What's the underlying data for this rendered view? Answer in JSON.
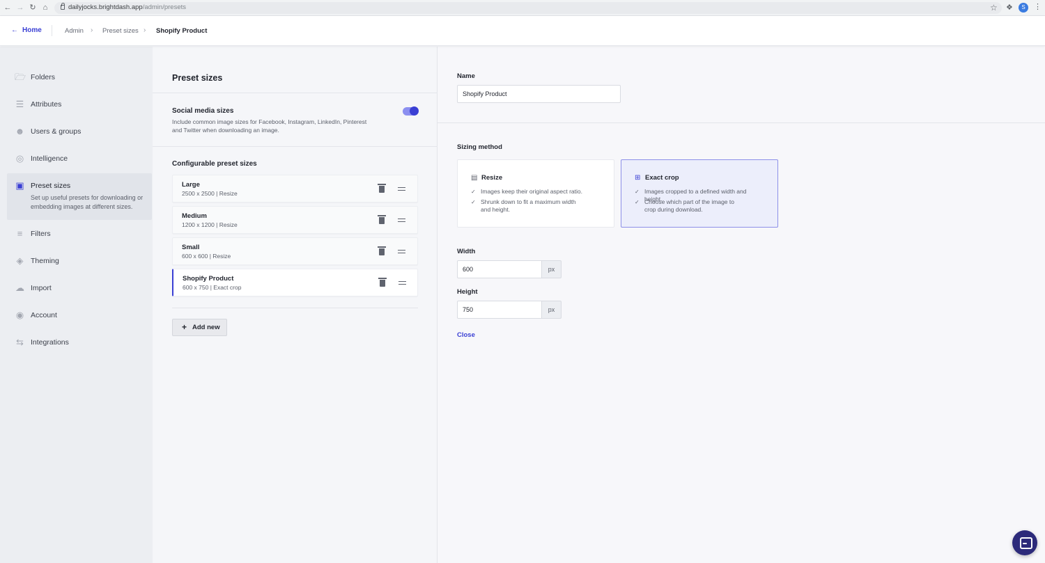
{
  "browser": {
    "url_host": "dailyjocks.brightdash.app",
    "url_path": "/admin/presets",
    "profile_initial": "S"
  },
  "header": {
    "home_label": "Home",
    "breadcrumbs": [
      "Admin",
      "Preset sizes",
      "Shopify Product"
    ]
  },
  "sidebar": {
    "items": [
      {
        "label": "Folders",
        "icon": "folder-icon"
      },
      {
        "label": "Attributes",
        "icon": "list-icon"
      },
      {
        "label": "Users & groups",
        "icon": "users-icon"
      },
      {
        "label": "Intelligence",
        "icon": "fingerprint-icon"
      },
      {
        "label": "Preset sizes",
        "icon": "image-resize-icon",
        "active": true,
        "description": "Set up useful presets for downloading or embedding images at different sizes."
      },
      {
        "label": "Filters",
        "icon": "sliders-icon"
      },
      {
        "label": "Theming",
        "icon": "paint-bucket-icon"
      },
      {
        "label": "Import",
        "icon": "cloud-upload-icon"
      },
      {
        "label": "Account",
        "icon": "user-circle-icon"
      },
      {
        "label": "Integrations",
        "icon": "arrows-icon"
      }
    ]
  },
  "presets_panel": {
    "title": "Preset sizes",
    "social": {
      "title": "Social media sizes",
      "description": "Include common image sizes for Facebook, Instagram, LinkedIn, Pinterest and Twitter when downloading an image.",
      "enabled": true
    },
    "configurable_title": "Configurable preset sizes",
    "presets": [
      {
        "name": "Large",
        "meta": "2500 x 2500 | Resize"
      },
      {
        "name": "Medium",
        "meta": "1200 x 1200 | Resize"
      },
      {
        "name": "Small",
        "meta": "600 x 600 | Resize"
      },
      {
        "name": "Shopify Product",
        "meta": "600 x 750 | Exact crop",
        "selected": true
      }
    ],
    "add_label": "Add new"
  },
  "editor": {
    "name_label": "Name",
    "name_value": "Shopify Product",
    "sizing_label": "Sizing method",
    "methods": [
      {
        "title": "Resize",
        "bullets": [
          "Images keep their original aspect ratio.",
          "Shrunk down to fit a maximum width and height."
        ],
        "selected": false
      },
      {
        "title": "Exact crop",
        "bullets": [
          "Images cropped to a defined width and height.",
          "Choose which part of the image to crop during download."
        ],
        "selected": true
      }
    ],
    "width_label": "Width",
    "width_value": "600",
    "height_label": "Height",
    "height_value": "750",
    "unit": "px",
    "close_label": "Close"
  },
  "colors": {
    "accent": "#3a3fd4",
    "selected_card_bg": "#eceefb"
  }
}
